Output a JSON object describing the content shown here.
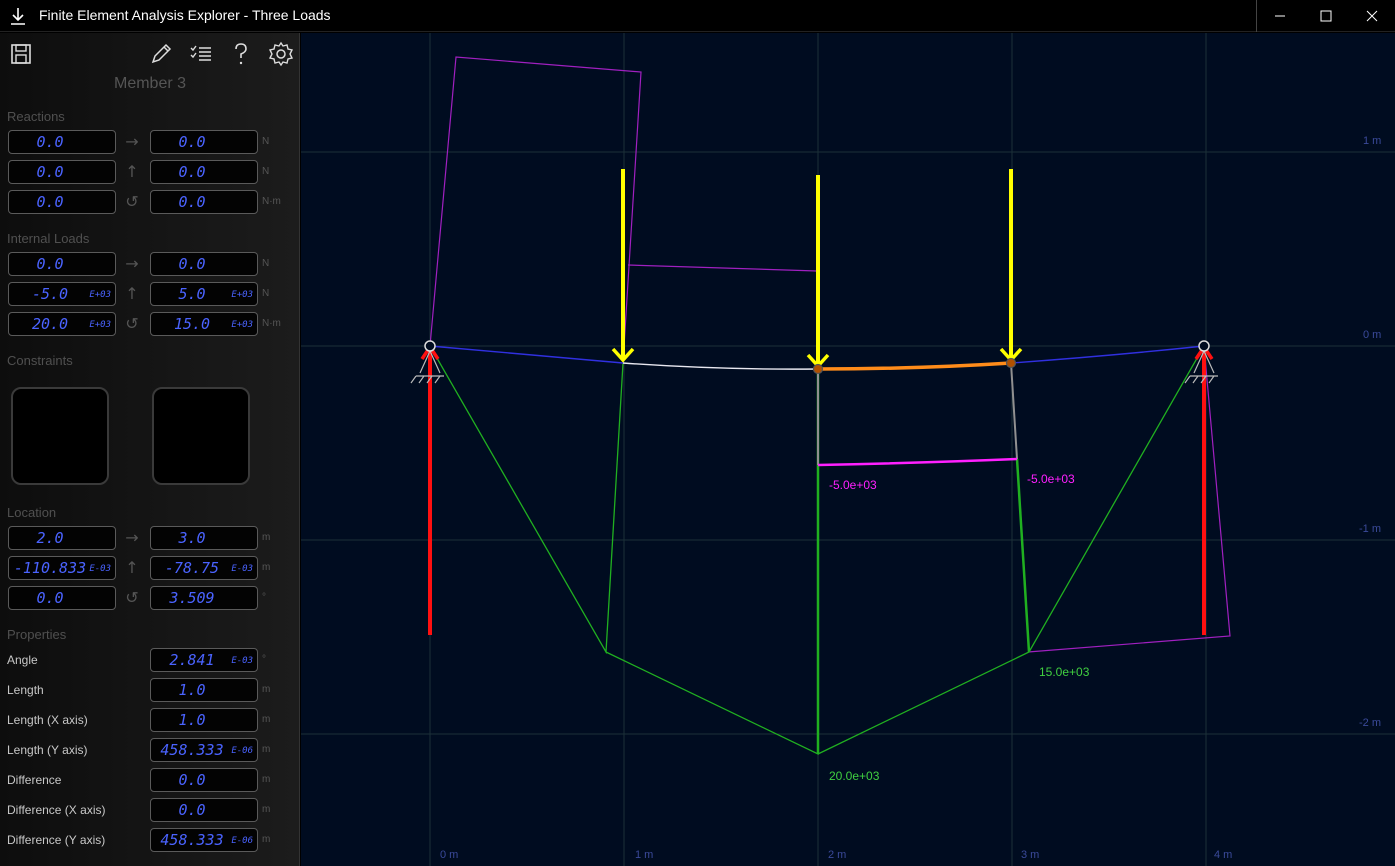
{
  "window": {
    "title": "Finite Element Analysis Explorer - Three Loads"
  },
  "toolbar": {
    "icons": [
      "save-icon",
      "edit-icon",
      "checklist-icon",
      "help-icon",
      "settings-icon"
    ]
  },
  "member_title": "Member 3",
  "reactions": {
    "label": "Reactions",
    "rows": [
      {
        "left": "0.0",
        "right": "0.0",
        "unit": "N",
        "arrow": "→"
      },
      {
        "left": "0.0",
        "right": "0.0",
        "unit": "N",
        "arrow": "↑"
      },
      {
        "left": "0.0",
        "right": "0.0",
        "unit": "N·m",
        "arrow": "↺"
      }
    ]
  },
  "internal_loads": {
    "label": "Internal Loads",
    "rows": [
      {
        "left": "0.0",
        "left_exp": "",
        "right": "0.0",
        "right_exp": "",
        "unit": "N",
        "arrow": "→"
      },
      {
        "left": "-5.0",
        "left_exp": "E+03",
        "right": "5.0",
        "right_exp": "E+03",
        "unit": "N",
        "arrow": "↑"
      },
      {
        "left": "20.0",
        "left_exp": "E+03",
        "right": "15.0",
        "right_exp": "E+03",
        "unit": "N·m",
        "arrow": "↺"
      }
    ]
  },
  "constraints": {
    "label": "Constraints"
  },
  "location": {
    "label": "Location",
    "rows": [
      {
        "left": "2.0",
        "left_exp": "",
        "right": "3.0",
        "right_exp": "",
        "unit": "m",
        "arrow": "→"
      },
      {
        "left": "-110.833",
        "left_exp": "E-03",
        "right": "-78.75",
        "right_exp": "E-03",
        "unit": "m",
        "arrow": "↑"
      },
      {
        "left": "0.0",
        "left_exp": "",
        "right": "3.509",
        "right_exp": "",
        "unit": "°",
        "arrow": "↺"
      }
    ]
  },
  "properties": {
    "label": "Properties",
    "rows": [
      {
        "name": "Angle",
        "value": "2.841",
        "exp": "E-03",
        "unit": "°"
      },
      {
        "name": "Length",
        "value": "1.0",
        "exp": "",
        "unit": "m"
      },
      {
        "name": "Length (X axis)",
        "value": "1.0",
        "exp": "",
        "unit": "m"
      },
      {
        "name": "Length (Y axis)",
        "value": "458.333",
        "exp": "E-06",
        "unit": "m"
      },
      {
        "name": "Difference",
        "value": "0.0",
        "exp": "",
        "unit": "m"
      },
      {
        "name": "Difference (X axis)",
        "value": "0.0",
        "exp": "",
        "unit": "m"
      },
      {
        "name": "Difference (Y axis)",
        "value": "458.333",
        "exp": "E-06",
        "unit": "m"
      }
    ]
  },
  "canvas": {
    "x_axis_labels": [
      "0 m",
      "1 m",
      "2 m",
      "3 m",
      "4 m"
    ],
    "y_axis_labels": [
      "1 m",
      "0 m",
      "-1 m",
      "-2 m"
    ],
    "shear_labels": [
      "-5.0e+03",
      "-5.0e+03"
    ],
    "moment_labels": [
      "15.0e+03",
      "20.0e+03"
    ],
    "colors": {
      "background": "#000c20",
      "member": "#3030e0",
      "selected_member": "#ff8c1a",
      "load": "#ffff00",
      "reaction": "#ff1010",
      "moment": "#20b020",
      "shear": "#ff20ff",
      "outline": "#a020c0"
    }
  }
}
